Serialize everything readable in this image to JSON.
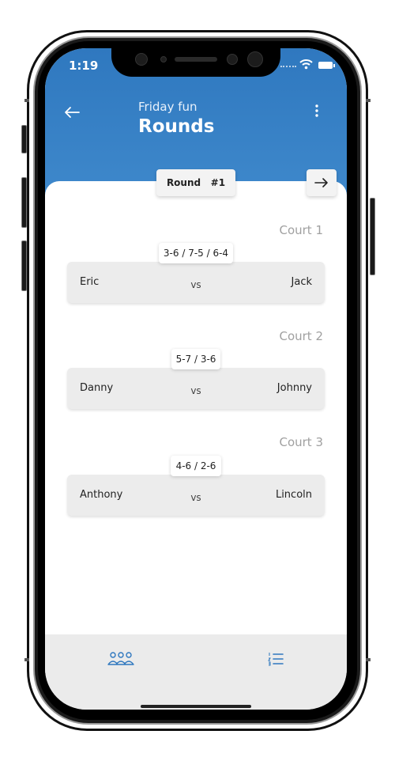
{
  "status_bar": {
    "time": "1:19"
  },
  "header": {
    "subtitle": "Friday fun",
    "title": "Rounds",
    "back_icon": "arrow-left-icon",
    "menu_icon": "more-vertical-icon"
  },
  "round": {
    "label": "Round",
    "number": "#1",
    "next_icon": "arrow-right-icon"
  },
  "courts": [
    {
      "label": "Court 1",
      "score": "3-6 / 7-5 / 6-4",
      "player_left": "Eric",
      "vs": "vs",
      "player_right": "Jack"
    },
    {
      "label": "Court 2",
      "score": "5-7 / 3-6",
      "player_left": "Danny",
      "vs": "vs",
      "player_right": "Johnny"
    },
    {
      "label": "Court 3",
      "score": "4-6 / 2-6",
      "player_left": "Anthony",
      "vs": "vs",
      "player_right": "Lincoln"
    }
  ],
  "bottom_nav": {
    "left_icon": "players-group-icon",
    "right_icon": "numbered-list-icon"
  },
  "colors": {
    "header": "#3580c5",
    "accent": "#2f78bf",
    "card": "#ececec",
    "court_label": "#a0a0a0"
  }
}
